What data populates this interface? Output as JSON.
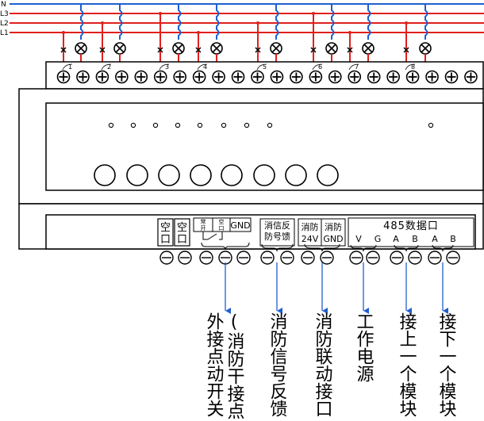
{
  "bus": {
    "lines": [
      "N",
      "L3",
      "L2",
      "L1"
    ],
    "line_colors": [
      "#0000ff",
      "#ff0000",
      "#ff0000",
      "#ff0000"
    ]
  },
  "channels": [
    "1",
    "2",
    "3",
    "4",
    "5",
    "6",
    "7",
    "8"
  ],
  "blocks": {
    "b1": {
      "top": "空",
      "bottom": "口"
    },
    "b2": {
      "top": "空",
      "bottom": "口"
    },
    "b3": {
      "a1": "常",
      "a2": "开",
      "b1": "空",
      "b2": "口",
      "gnd": "GND"
    },
    "b4": {
      "row1": "消信反",
      "row2": "防号馈"
    },
    "b5": {
      "row1": "消防",
      "row2": "24V"
    },
    "b6": {
      "row1": "消防",
      "row2": "GND"
    },
    "b7": {
      "title": "485数据口",
      "v": "V",
      "g": "G",
      "a1": "A",
      "b1": "B",
      "a2": "A",
      "b2": "B"
    }
  },
  "captions": {
    "c1a": "外接点动开关",
    "c1b": "(消防干接点)",
    "c2": "消防信号反馈",
    "c3": "消防联动接口",
    "c4": "工作电源",
    "c5": "接上一个模块",
    "c6": "接下一个模块"
  }
}
